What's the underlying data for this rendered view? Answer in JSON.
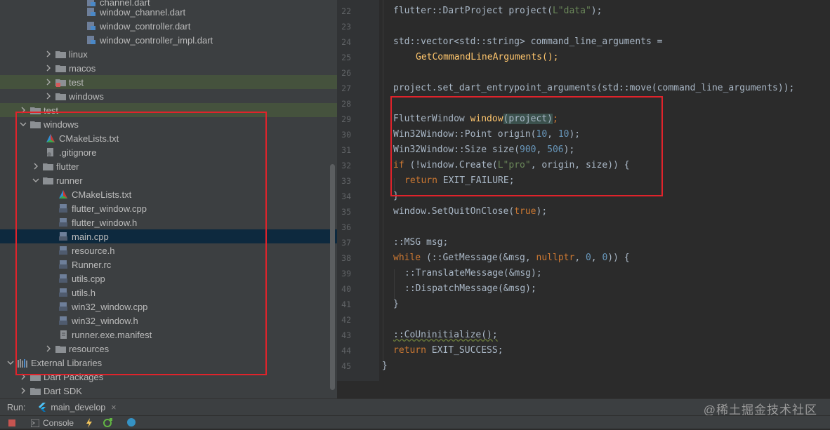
{
  "tree": {
    "rows": [
      {
        "label": "channel.dart",
        "icon": "dart-file-icon"
      },
      {
        "label": "window_channel.dart",
        "icon": "dart-file-icon"
      },
      {
        "label": "window_controller.dart",
        "icon": "dart-file-icon"
      },
      {
        "label": "window_controller_impl.dart",
        "icon": "dart-file-icon"
      },
      {
        "label": "linux",
        "icon": "folder-icon"
      },
      {
        "label": "macos",
        "icon": "folder-icon"
      },
      {
        "label": "test",
        "icon": "test-folder-icon"
      },
      {
        "label": "windows",
        "icon": "folder-icon"
      },
      {
        "label": "test",
        "icon": "folder-icon"
      },
      {
        "label": "windows",
        "icon": "folder-icon"
      },
      {
        "label": "CMakeLists.txt",
        "icon": "cmake-icon"
      },
      {
        "label": ".gitignore",
        "icon": "gitignore-icon"
      },
      {
        "label": "flutter",
        "icon": "folder-icon"
      },
      {
        "label": "runner",
        "icon": "folder-icon"
      },
      {
        "label": "CMakeLists.txt",
        "icon": "cmake-icon"
      },
      {
        "label": "flutter_window.cpp",
        "icon": "cpp-file-icon"
      },
      {
        "label": "flutter_window.h",
        "icon": "header-file-icon"
      },
      {
        "label": "main.cpp",
        "icon": "cpp-file-icon"
      },
      {
        "label": "resource.h",
        "icon": "header-file-icon"
      },
      {
        "label": "Runner.rc",
        "icon": "rc-file-icon"
      },
      {
        "label": "utils.cpp",
        "icon": "cpp-file-icon"
      },
      {
        "label": "utils.h",
        "icon": "header-file-icon"
      },
      {
        "label": "win32_window.cpp",
        "icon": "cpp-file-icon"
      },
      {
        "label": "win32_window.h",
        "icon": "header-file-icon"
      },
      {
        "label": "runner.exe.manifest",
        "icon": "manifest-file-icon"
      },
      {
        "label": "resources",
        "icon": "folder-icon"
      },
      {
        "label": "External Libraries",
        "icon": "libraries-icon"
      },
      {
        "label": "Dart Packages",
        "icon": "folder-icon"
      },
      {
        "label": "Dart SDK",
        "icon": "folder-icon"
      }
    ]
  },
  "editor": {
    "line_numbers": [
      "22",
      "23",
      "24",
      "25",
      "26",
      "27",
      "28",
      "29",
      "30",
      "31",
      "32",
      "33",
      "34",
      "35",
      "36",
      "37",
      "38",
      "39",
      "40",
      "41",
      "42",
      "43",
      "44",
      "45"
    ],
    "l22": {
      "a": "flutter::DartProject project(",
      "b": "L\"data\"",
      "c": ");"
    },
    "l24": {
      "a": "std::vector<std::string> command_line_arguments ="
    },
    "l25": {
      "a": "GetCommandLineArguments();"
    },
    "l27": {
      "a": "project.set_dart_entrypoint_arguments(std::move(command_line_arguments));"
    },
    "l29": {
      "a": "FlutterWindow ",
      "b": "window",
      "c": "(",
      "d": "project",
      "e": ")",
      "f": ";"
    },
    "l30": {
      "a": "Win32Window::Point origin(",
      "b": "10",
      "c": ", ",
      "d": "10",
      "e": ");"
    },
    "l31": {
      "a": "Win32Window::Size size(",
      "b": "900",
      "c": ", ",
      "d": "506",
      "e": ");"
    },
    "l32": {
      "a": "if",
      "b": " (!window.Create(",
      "c": "L\"pro\"",
      "d": ", origin, size)) {"
    },
    "l33": {
      "a": "return",
      "b": " EXIT_FAILURE;"
    },
    "l34": {
      "a": "}"
    },
    "l35": {
      "a": "window.SetQuitOnClose(",
      "b": "true",
      "c": ");"
    },
    "l37": {
      "a": "::MSG msg;"
    },
    "l38": {
      "a": "while",
      "b": " (::GetMessage(&msg, ",
      "c": "nullptr",
      "d": ", ",
      "e": "0",
      "f": ", ",
      "g": "0",
      "h": ")) {"
    },
    "l39": {
      "a": "::TranslateMessage(&msg);"
    },
    "l40": {
      "a": "::DispatchMessage(&msg);"
    },
    "l41": {
      "a": "}"
    },
    "l43": {
      "a": "::CoUninitialize();"
    },
    "l44": {
      "a": "return",
      "b": " EXIT_SUCCESS;"
    },
    "l45": {
      "a": "}"
    }
  },
  "runbar": {
    "label": "Run:",
    "tab": "main_develop",
    "close": "×"
  },
  "toolbar": {
    "console": "Console"
  },
  "watermark": "@稀土掘金技术社区",
  "colors": {
    "annotation_box": "#e0232b",
    "selected_row": "#0d293e",
    "highlighted_row": "#45523d"
  }
}
